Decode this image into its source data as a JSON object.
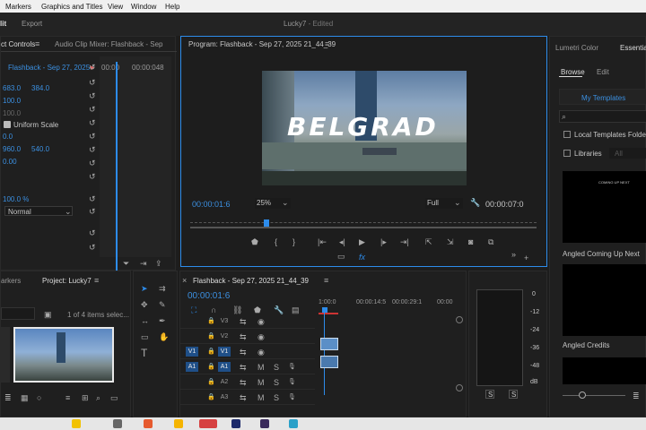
{
  "menu": [
    "Markers",
    "Graphics and Titles",
    "View",
    "Window",
    "Help"
  ],
  "workspace_tabs": [
    "lit",
    "Export"
  ],
  "doc_title": "Lucky7",
  "doc_status": " - Edited",
  "effect_controls": {
    "tab": "ct Controls",
    "mixer_tab": "Audio Clip Mixer: Flashback - Sep",
    "clip": "Flashback - Sep 27, 2025",
    "timecode_start": "00:00",
    "timecode_end": "00:00:048",
    "position": [
      "683.0",
      "384.0"
    ],
    "scale": "100.0",
    "scale2": "100.0",
    "uniform_scale": "Uniform Scale",
    "rotation": "0.0",
    "anchor": [
      "960.0",
      "540.0"
    ],
    "anti_flicker": "0.00",
    "opacity": "100.0 %",
    "blend_mode": "Normal"
  },
  "program": {
    "title": "Program: Flashback - Sep 27, 2025 21_44_39",
    "overlay_text": "BELGRAD",
    "timecode": "00:00:01:6",
    "zoom": "25%",
    "quality": "Full",
    "duration": "00:00:07:0",
    "playhead_fraction": 0.22
  },
  "project": {
    "markers_tab": "arkers",
    "tab": "Project: Lucky7",
    "items": "1 of 4 items selec..."
  },
  "timeline": {
    "title": "Flashback - Sep 27, 2025 21_44_39",
    "timecode": "00:00:01:6",
    "ruler": [
      "1:00:0",
      "00:00:14:5",
      "00:00:29:1",
      "00:00"
    ],
    "tracks": [
      {
        "name": "V3",
        "src": "",
        "kind": "video"
      },
      {
        "name": "V2",
        "src": "",
        "kind": "video"
      },
      {
        "name": "V1",
        "src": "V1",
        "kind": "video"
      },
      {
        "name": "A1",
        "src": "A1",
        "kind": "audio"
      },
      {
        "name": "A2",
        "src": "",
        "kind": "audio"
      },
      {
        "name": "A3",
        "src": "",
        "kind": "audio"
      }
    ],
    "m_label": "M",
    "s_label": "S"
  },
  "meter": {
    "scale": [
      "0",
      "-12",
      "-24",
      "-36",
      "-48",
      "dB"
    ],
    "solo_left": "S",
    "solo_right": "S"
  },
  "essential": {
    "lumetri_tab": "Lumetri Color",
    "tab": "Essentia",
    "browse": "Browse",
    "edit": "Edit",
    "my_templates": "My Templates",
    "local_templates": "Local Templates Folder",
    "libraries": "Libraries",
    "all": "All",
    "template1_preview": "COMING UP NEXT",
    "template1": "Angled Coming Up Next",
    "template2": "Angled Credits"
  },
  "colors": {
    "accent": "#2d8ceb",
    "panel": "#1f1f1f",
    "clip_blue": "#5b8fc7"
  }
}
